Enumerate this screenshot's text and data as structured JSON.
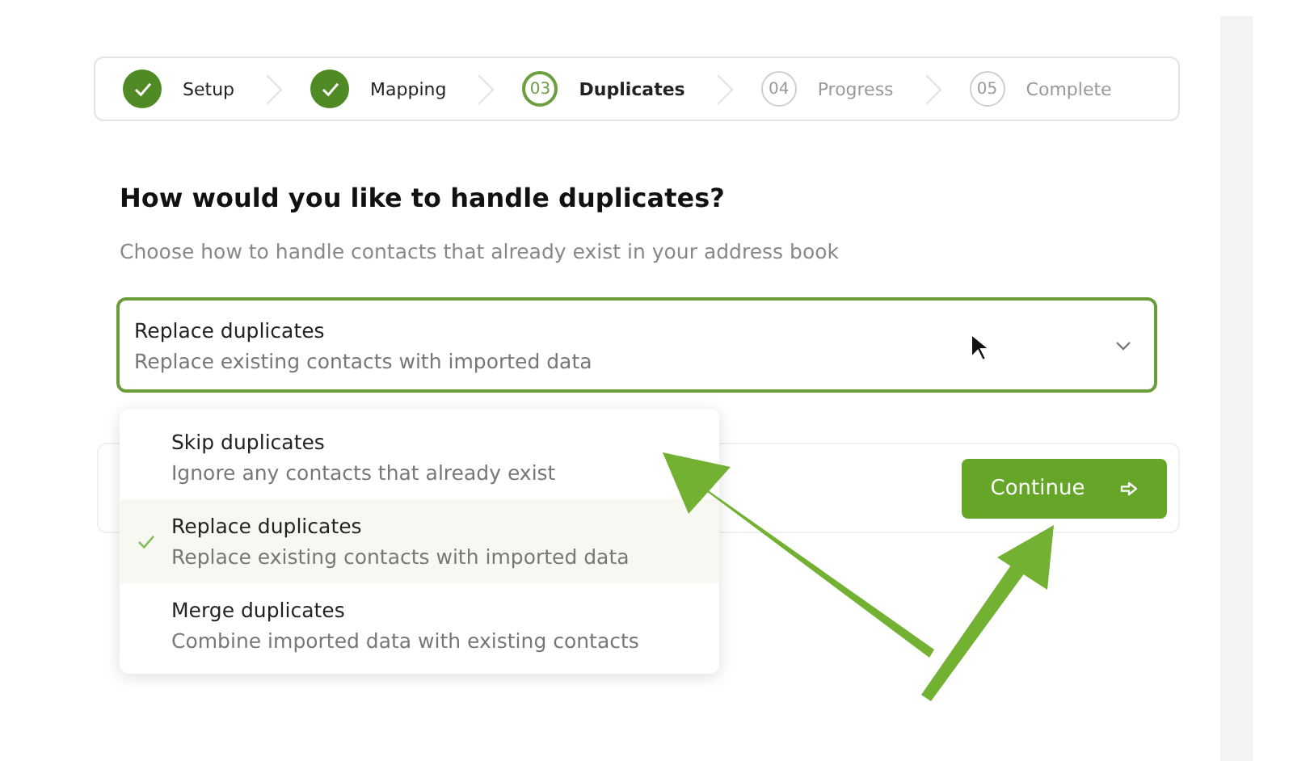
{
  "steps": [
    {
      "label": "Setup",
      "completed": true,
      "current": false
    },
    {
      "label": "Mapping",
      "completed": true,
      "current": false
    },
    {
      "number": "03",
      "label": "Duplicates",
      "completed": false,
      "current": true
    },
    {
      "number": "04",
      "label": "Progress",
      "completed": false,
      "current": false
    },
    {
      "number": "05",
      "label": "Complete",
      "completed": false,
      "current": false
    }
  ],
  "heading": "How would you like to handle duplicates?",
  "subtitle": "Choose how to handle contacts that already exist in your address book",
  "select": {
    "title": "Replace duplicates",
    "description": "Replace existing contacts with imported data",
    "expanded": true
  },
  "options": [
    {
      "title": "Skip duplicates",
      "description": "Ignore any contacts that already exist",
      "selected": false
    },
    {
      "title": "Replace duplicates",
      "description": "Replace existing contacts with imported data",
      "selected": true
    },
    {
      "title": "Merge duplicates",
      "description": "Combine imported data with existing contacts",
      "selected": false
    }
  ],
  "continue_button": "Continue"
}
